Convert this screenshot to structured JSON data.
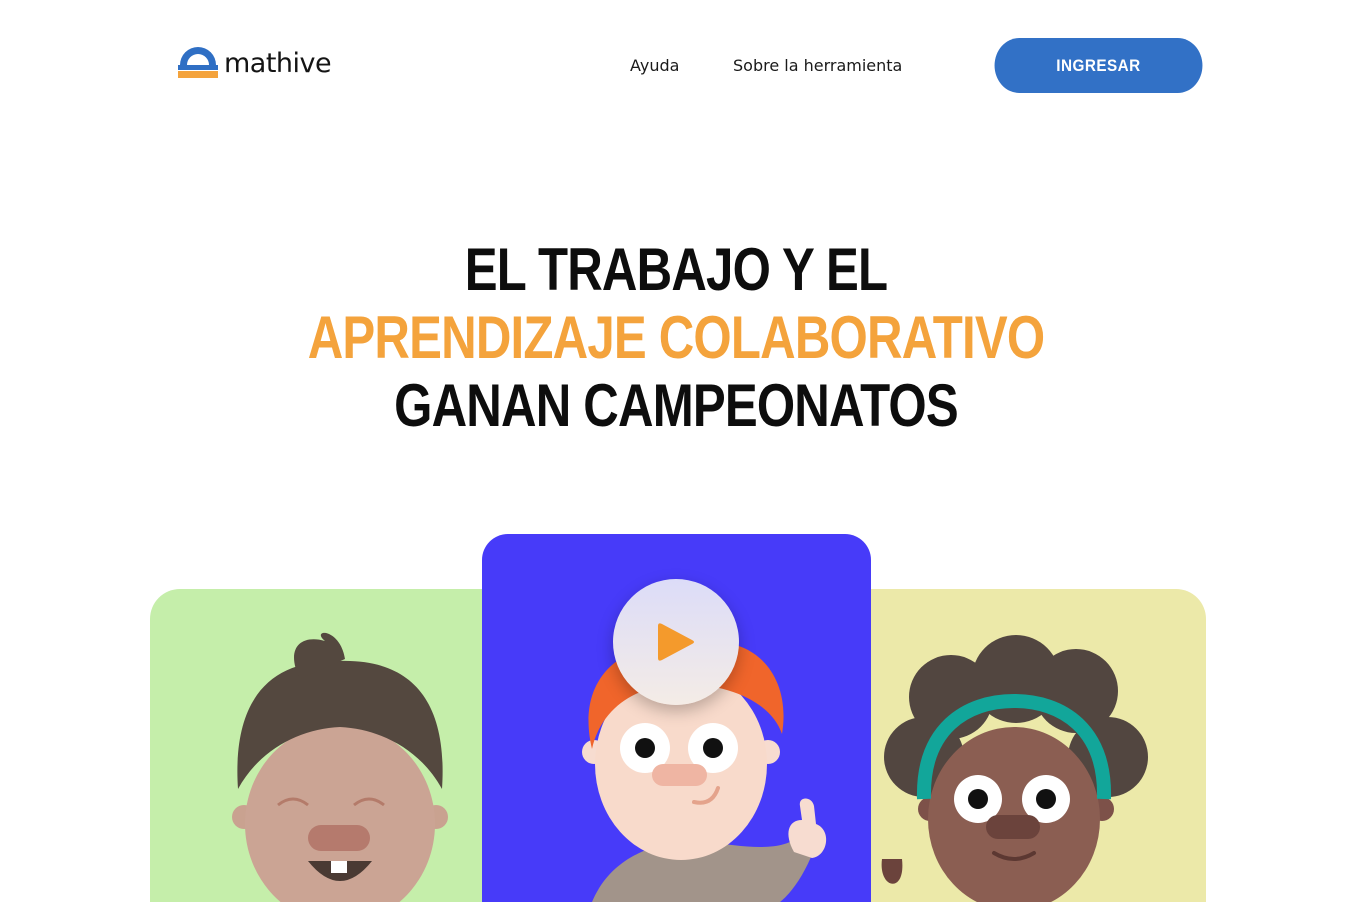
{
  "header": {
    "brand": "mathive",
    "nav": [
      {
        "label": "Ayuda"
      },
      {
        "label": "Sobre la herramienta"
      }
    ],
    "login_label": "INGRESAR"
  },
  "hero": {
    "title_part1": "EL TRABAJO Y EL ",
    "title_accent": "APRENDIZAJE COLABORATIVO",
    "title_part2": " GANAN CAMPEONATOS"
  },
  "colors": {
    "brand_blue": "#3271c6",
    "accent_orange": "#f4a33c",
    "card_green": "#c5eeaa",
    "card_blue": "#473bf9",
    "card_yellow": "#ece9a9"
  },
  "icons": {
    "logo": "protractor-logo-icon",
    "play": "play-icon"
  }
}
